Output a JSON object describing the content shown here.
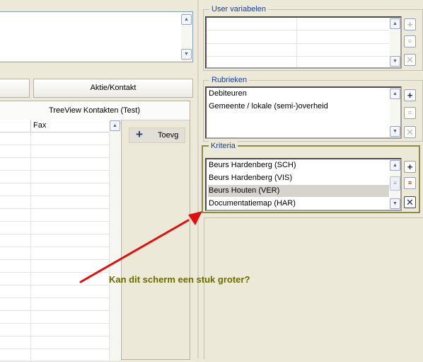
{
  "user_variabelen": {
    "title": "User variabelen"
  },
  "rubrieken": {
    "title": "Rubrieken",
    "items": [
      "Debiteuren",
      "Gemeente / lokale (semi-)overheid"
    ]
  },
  "kriteria": {
    "title": "Kriteria",
    "items": [
      "Beurs Hardenberg (SCH)",
      "Beurs Hardenberg (VIS)",
      "Beurs Houten (VER)",
      "Documentatiemap (HAR)"
    ],
    "selected_index": 2
  },
  "left": {
    "tab_label": "Aktie/Kontakt",
    "tree_title": "TreeView Kontakten (Test)",
    "column_fax": "Fax",
    "add_label": "Toevg"
  },
  "annotation": {
    "text": "Kan dit scherm een stuk groter?",
    "color": "#6b6b00",
    "arrow_color": "#e01010"
  },
  "icons": {
    "add": "plus-icon",
    "edit": "edit-list-icon",
    "delete": "delete-x-icon",
    "scroll_up": "scroll-up-icon",
    "scroll_down": "scroll-down-icon"
  }
}
